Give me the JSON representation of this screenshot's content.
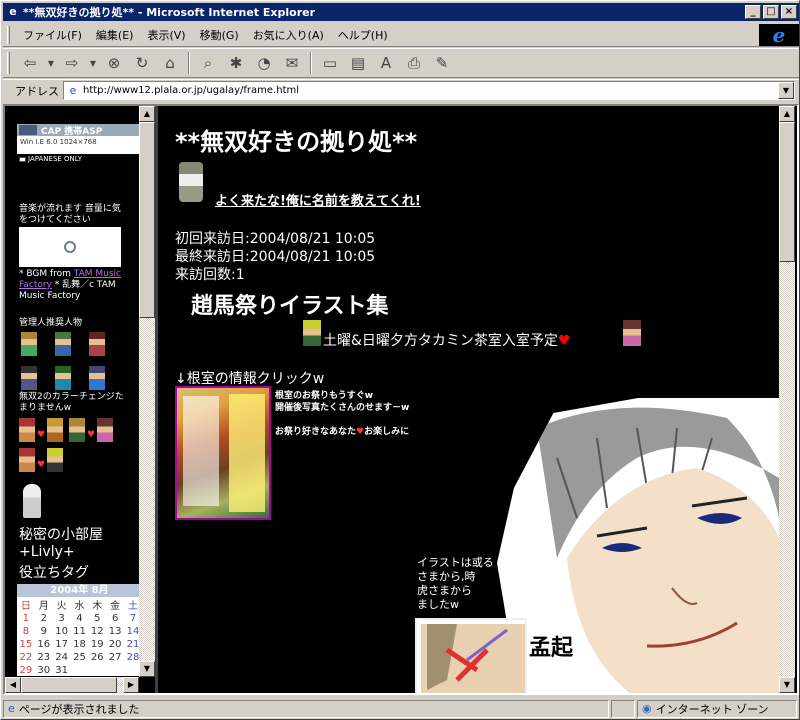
{
  "window": {
    "title": "**無双好きの拠り処** - Microsoft Internet Explorer",
    "min": "_",
    "max": "□",
    "close": "×"
  },
  "menu": [
    "ファイル(F)",
    "編集(E)",
    "表示(V)",
    "移動(G)",
    "お気に入り(A)",
    "ヘルプ(H)"
  ],
  "toolbar": {
    "icons": [
      "back-icon",
      "forward-icon",
      "stop-icon",
      "refresh-icon",
      "home-icon",
      "search-icon",
      "favorites-icon",
      "history-icon",
      "mail-icon",
      "fullscreen-icon",
      "channels-icon",
      "font-icon",
      "print-icon",
      "edit-icon"
    ]
  },
  "address": {
    "label": "アドレス",
    "url": "http://www12.plala.or.jp/ugalay/frame.html"
  },
  "left": {
    "cap_text": "CAP 携帯ASP",
    "browser_line": "Win  I.E 6.0  1024×768",
    "japanese_only": "JAPANESE ONLY",
    "music_notice": "音楽が流れます 音量に気をつけてください",
    "bgm_prefix": "* BGM from ",
    "bgm_link": "TAM Music Factory",
    "bgm_suffix": " * 乱舞／c TAM Music Factory",
    "recommended": "管理人推奨人物",
    "color_change": "無双2のカラーチェンジたまりませんw",
    "secret_room": "秘密の小部屋",
    "livly": "+Livly+",
    "useful_tags": "役立ちタグ",
    "calendar": {
      "header": "2004年 8月",
      "weekdays": [
        "日",
        "月",
        "火",
        "水",
        "木",
        "金",
        "土"
      ],
      "rows": [
        [
          "1",
          "2",
          "3",
          "4",
          "5",
          "6",
          "7"
        ],
        [
          "8",
          "9",
          "10",
          "11",
          "12",
          "13",
          "14"
        ],
        [
          "15",
          "16",
          "17",
          "18",
          "19",
          "20",
          "21"
        ],
        [
          "22",
          "23",
          "24",
          "25",
          "26",
          "27",
          "28"
        ],
        [
          "29",
          "30",
          "31",
          "",
          "",
          "",
          ""
        ]
      ]
    }
  },
  "main": {
    "title": "**無双好きの拠り処**",
    "name_link": "よく来たな!俺に名前を教えてくれ!",
    "first_visit": "初回来訪日:2004/08/21 10:05",
    "last_visit": "最終来訪日:2004/08/21 10:05",
    "visit_count": "来訪回数:1",
    "illust_heading": "趙馬祭りイラスト集",
    "tea_room": "土曜&日曜夕方タカミン茶室入室予定",
    "info_click": "↓根室の情報クリックw",
    "festival_1": "根室のお祭りもうすぐw",
    "festival_2": "開催後写真たくさんのせます－w",
    "festival_3_a": "お祭り好きなあなた",
    "festival_3_b": "お楽しみに",
    "illust_note_1": "イラストは或る",
    "illust_note_2": "さまから,時",
    "illust_note_3": "虎さまから",
    "illust_note_4": "ましたw",
    "meng_qi": "孟起"
  },
  "status": {
    "text": "ページが表示されました",
    "zone": "インターネット ゾーン"
  },
  "colors": {
    "title_bar": "#0a246a",
    "link_purple": "#b070e0",
    "page_bg": "#000000"
  }
}
